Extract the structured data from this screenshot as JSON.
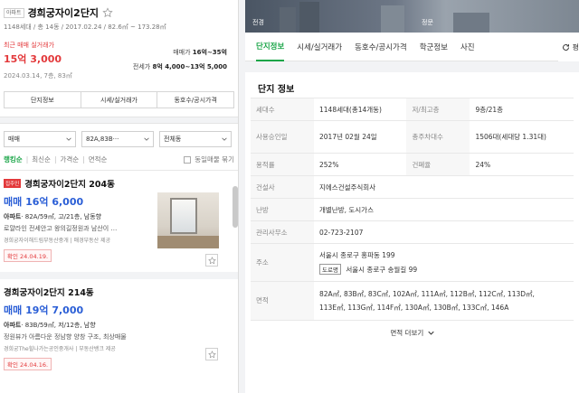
{
  "complex": {
    "type_badge": "아파트",
    "name": "경희궁자이2단지",
    "meta": "1148세대 / 총 14동 / 2017.02.24 / 82.6㎡ ~ 173.28㎡"
  },
  "recent_trade": {
    "label": "최근 매매 실거래가",
    "price": "15억 3,000",
    "date": "2024.03.14, 7층, 83㎡"
  },
  "ranges": {
    "sale_label": "매매가",
    "sale_value": "16억~35억",
    "jeonse_label": "전세가",
    "jeonse_value": "8억 4,000~13억 5,000"
  },
  "left_tabs": [
    "단지정보",
    "시세/실거래가",
    "동호수/공시가격"
  ],
  "filters": {
    "trade": "매매",
    "area": "82A,83B···",
    "dong": "전체동"
  },
  "sort": {
    "items": [
      "랭킹순",
      "최신순",
      "가격순",
      "면적순"
    ],
    "active": "랭킹순",
    "same_listing": "동일매물 묶기"
  },
  "listings": [
    {
      "badge": "집주인",
      "title": "경희궁자이2단지 204동",
      "price": "매매 16억 6,000",
      "type": "아파트",
      "spec": "· 82A/59㎡, 고/21층, 남동향",
      "desc": "로얄라인 전세안고 왕의길정원과 남산이 …",
      "agent": "경희궁자이해드림부동산중개 | 매경부동산 제공",
      "confirm": "확인 24.04.19."
    },
    {
      "badge": "",
      "title": "경희궁자이2단지 214동",
      "price": "매매 19억 7,000",
      "type": "아파트",
      "spec": "· 83B/59㎡, 저/12층, 남향",
      "desc": "정원뷰가 아름다운 정남향 양창 구조, 최상매물",
      "agent": "경희궁The힐나가는공인중개사 | 부동산뱅크 제공",
      "confirm": "확인 24.04.16."
    }
  ],
  "photos": {
    "label1": "전경",
    "label2": "정문"
  },
  "right_tabs": [
    "단지정보",
    "시세/실거래가",
    "동호수/공시가격",
    "학군정보",
    "사진"
  ],
  "right_active": "단지정보",
  "share_label": "평",
  "info": {
    "title": "단지 정보",
    "rows": {
      "households_k": "세대수",
      "households_v": "1148세대(총14개동)",
      "floors_k": "저/최고층",
      "floors_v": "9층/21층",
      "approval_k": "사용승인일",
      "approval_v": "2017년 02월 24일",
      "parking_k": "총주차대수",
      "parking_v": "1506대(세대당 1.31대)",
      "far_k": "용적률",
      "far_v": "252%",
      "bcr_k": "건폐율",
      "bcr_v": "24%",
      "builder_k": "건설사",
      "builder_v": "지에스건설주식회사",
      "heating_k": "난방",
      "heating_v": "개별난방, 도시가스",
      "office_k": "관리사무소",
      "office_v": "02-723-2107",
      "address_k": "주소",
      "address_v1": "서울시 종로구 홍파동 199",
      "road_badge": "도로명",
      "address_v2": "서울시 종로구 송월길 99",
      "area_k": "면적",
      "area_v1": "82A㎡, 83B㎡, 83C㎡, 102A㎡, 111A㎡, 112B㎡, 112C㎡, 113D㎡,",
      "area_v2": "113E㎡, 113G㎡, 114F㎡, 130A㎡, 130B㎡, 133C㎡, 146A"
    },
    "more": "면적 더보기"
  },
  "colors": {
    "accent_green": "#1aa548",
    "price_red": "#e3393b",
    "price_blue": "#2a5ed6"
  }
}
